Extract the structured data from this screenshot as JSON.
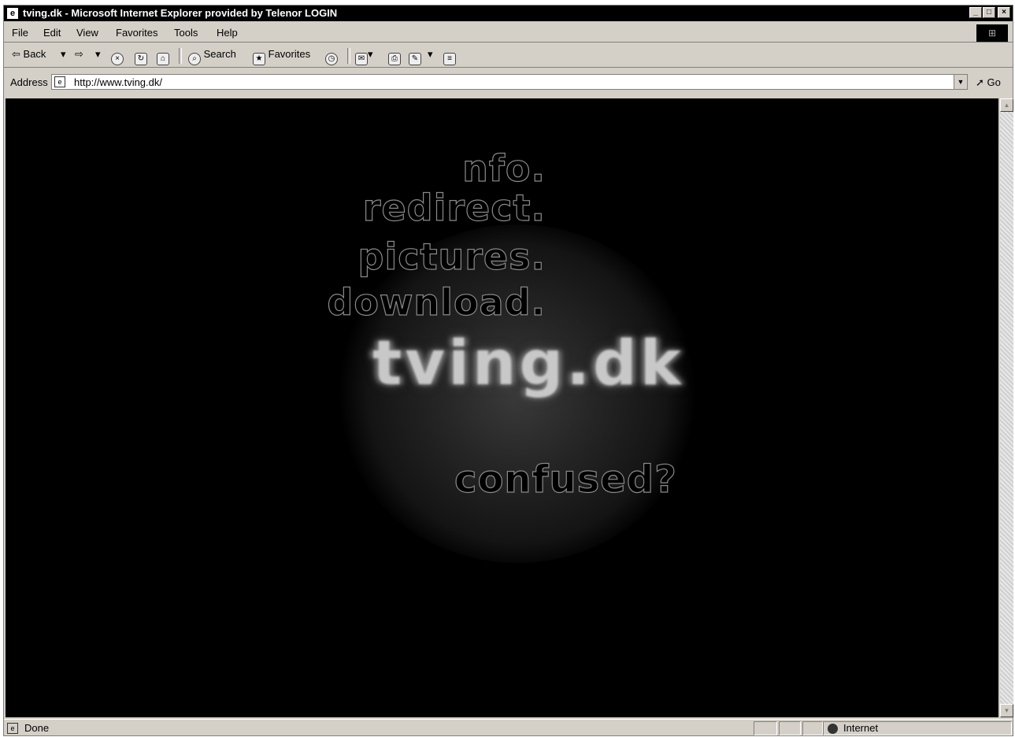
{
  "window": {
    "title": "tving.dk - Microsoft Internet Explorer provided by Telenor LOGIN",
    "min_glyph": "_",
    "max_glyph": "□",
    "close_glyph": "×"
  },
  "menu": [
    "File",
    "Edit",
    "View",
    "Favorites",
    "Tools",
    "Help"
  ],
  "toolbar": {
    "back_label": "Back",
    "search_label": "Search",
    "favorites_label": "Favorites"
  },
  "address": {
    "label": "Address",
    "url": "http://www.tving.dk/",
    "go_label": "Go"
  },
  "page": {
    "links": [
      "nfo.",
      "redirect.",
      "pictures.",
      "download."
    ],
    "logo_text": "tving.dk",
    "confused_text": "confused?"
  },
  "status": {
    "text": "Done",
    "zone": "Internet"
  },
  "colors": {
    "page_background": "#000000",
    "outline_text": "#8a8a8a",
    "chrome": "#d4d0c8"
  }
}
